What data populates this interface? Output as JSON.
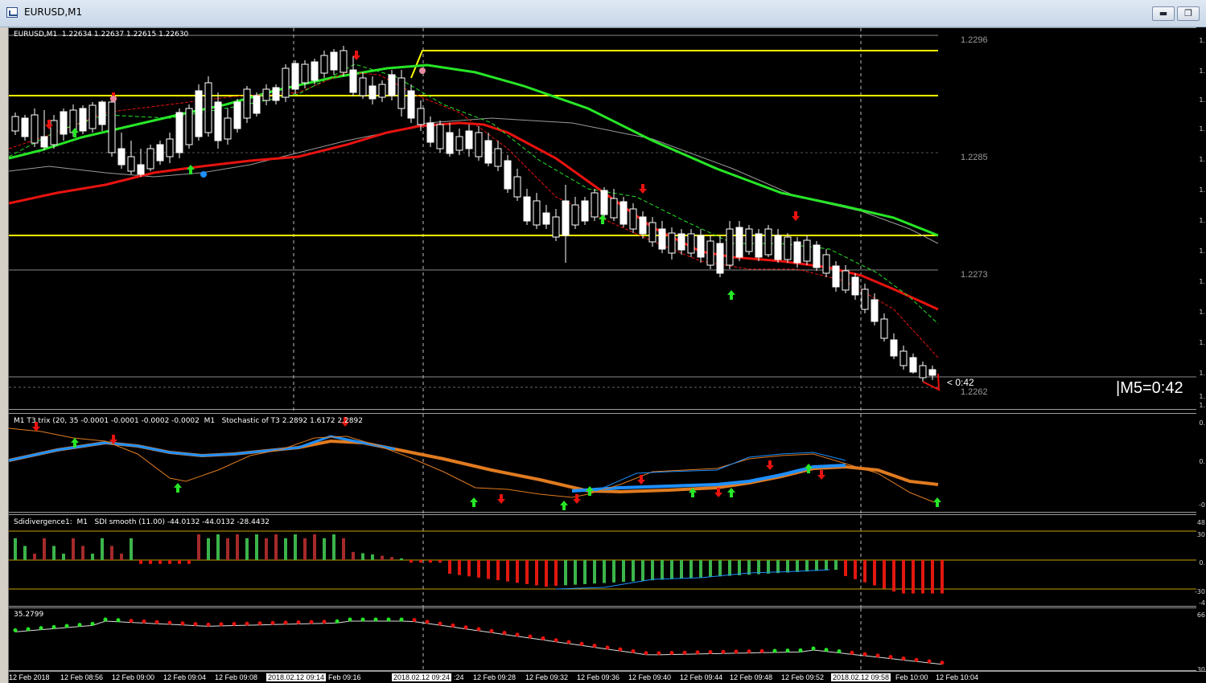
{
  "window": {
    "title": "EURUSD,M1",
    "minimize_label": "▬",
    "restore_label": "❐"
  },
  "main_pane": {
    "header": "EURUSD,M1  1.22634 1.22637 1.22615 1.22630",
    "price_labels": [
      "1.2296",
      "1.2285",
      "1.2273",
      "1.2262"
    ],
    "countdown": "< 0:42",
    "m5_timer": "|M5=0:42"
  },
  "pane_trix": {
    "header": "M1 T3 trix (20, 35 -0.0001 -0.0001 -0.0002 -0.0002  M1   Stochastic of T3 2.2892 1.6172 2.2892"
  },
  "pane_sdi": {
    "header": "Sdidivergence1:  M1   SDI smooth (11.00) -44.0132 -44.0132 -28.4432"
  },
  "pane_dots": {
    "header": "35.2799"
  },
  "right_scale": {
    "main": [
      "1.",
      "1.",
      "1.",
      "1.",
      "1.",
      "1.",
      "1.",
      "1.",
      "1.",
      "1.",
      "1.",
      "1.",
      "1.",
      "1."
    ],
    "trix": [
      "0.",
      "0.",
      "-0"
    ],
    "sdi": [
      "48",
      "30",
      "0.",
      "-30",
      "-4"
    ],
    "dots": [
      "66",
      "30"
    ]
  },
  "time_axis": [
    {
      "label": "12 Feb 2018",
      "highlight": false
    },
    {
      "label": "12 Feb 08:56",
      "highlight": false
    },
    {
      "label": "12 Feb 09:00",
      "highlight": false
    },
    {
      "label": "12 Feb 09:04",
      "highlight": false
    },
    {
      "label": "12 Feb 09:08",
      "highlight": false
    },
    {
      "label": "2018.02.12 09:14",
      "highlight": true
    },
    {
      "label": "Feb 09:16",
      "highlight": false
    },
    {
      "label": "2018.02.12 09:24",
      "highlight": true
    },
    {
      "label": ":24",
      "highlight": false
    },
    {
      "label": "12 Feb 09:28",
      "highlight": false
    },
    {
      "label": "12 Feb 09:32",
      "highlight": false
    },
    {
      "label": "12 Feb 09:36",
      "highlight": false
    },
    {
      "label": "12 Feb 09:40",
      "highlight": false
    },
    {
      "label": "12 Feb 09:44",
      "highlight": false
    },
    {
      "label": "12 Feb 09:48",
      "highlight": false
    },
    {
      "label": "12 Feb 09:52",
      "highlight": false
    },
    {
      "label": "2018.02.12 09:58",
      "highlight": true
    },
    {
      "label": "Feb 10:00",
      "highlight": false
    },
    {
      "label": "12 Feb 10:04",
      "highlight": false
    }
  ],
  "colors": {
    "background": "#000000",
    "bull_candle": "#ffffff",
    "bear_candle": "#ffffff",
    "ma_green": "#27e627",
    "ma_red": "#e8130f",
    "level_yellow": "#ffff00",
    "trix_blue": "#1e90ff",
    "trix_orange": "#e07b20",
    "hist_green": "#3cb44b",
    "hist_red": "#e0180f",
    "hist_dark_red": "#a52a2a"
  }
}
